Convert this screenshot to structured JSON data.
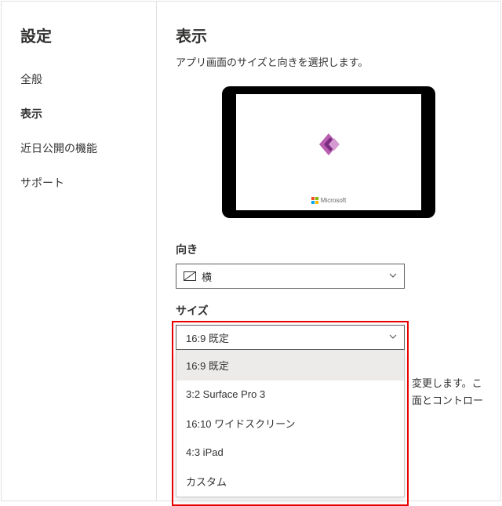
{
  "sidebar": {
    "title": "設定",
    "items": [
      {
        "label": "全般"
      },
      {
        "label": "表示"
      },
      {
        "label": "近日公開の機能"
      },
      {
        "label": "サポート"
      }
    ],
    "activeIndex": 1
  },
  "page": {
    "title": "表示",
    "description": "アプリ画面のサイズと向きを選択します。",
    "msBrand": "Microsoft"
  },
  "orientation": {
    "label": "向き",
    "value": "横"
  },
  "size": {
    "label": "サイズ",
    "value": "16:9 既定",
    "options": [
      "16:9 既定",
      "3:2 Surface Pro 3",
      "16:10 ワイドスクリーン",
      "4:3 iPad",
      "カスタム"
    ],
    "selectedIndex": 0
  },
  "behind": {
    "line1": "変更します。こ",
    "line2": "面とコントロー"
  }
}
